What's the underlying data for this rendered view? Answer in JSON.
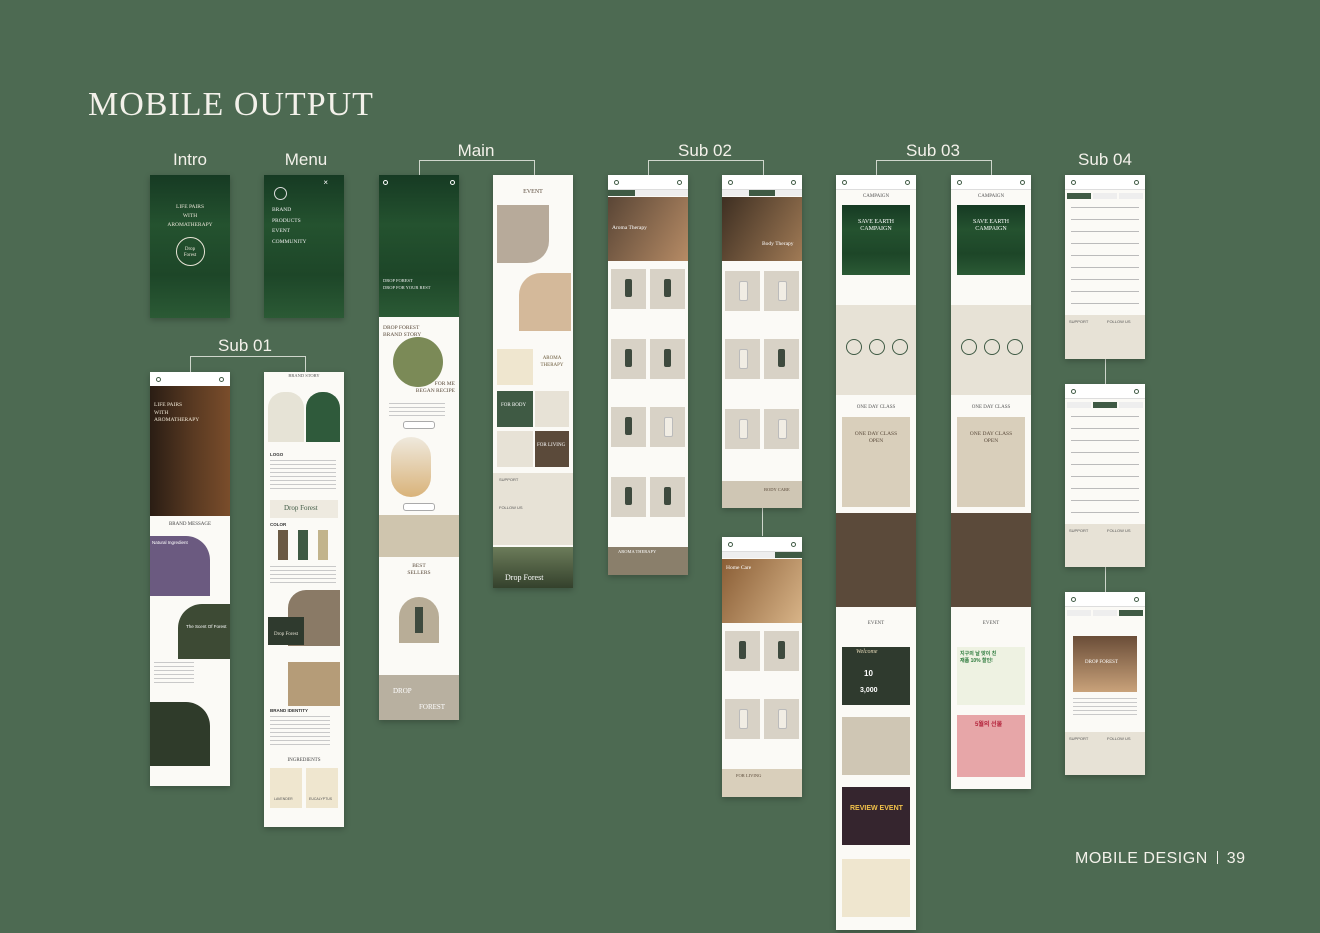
{
  "page": {
    "title": "MOBILE OUTPUT",
    "footer_label": "MOBILE DESIGN",
    "page_number": "39"
  },
  "groups": {
    "intro": "Intro",
    "menu": "Menu",
    "main": "Main",
    "sub01": "Sub 01",
    "sub02": "Sub 02",
    "sub03": "Sub 03",
    "sub04": "Sub 04"
  },
  "intro_screen": {
    "tagline_1": "LIFE PAIRS",
    "tagline_2": "WITH",
    "tagline_3": "AROMATHERAPY",
    "logo_1": "Drop",
    "logo_2": "Forest"
  },
  "menu_screen": {
    "items": [
      "BRAND",
      "PRODUCTS",
      "EVENT",
      "COMMUNITY"
    ],
    "close": "×"
  },
  "main_screen": {
    "hero_1": "DROP FOREST",
    "hero_2": "DROP FOR YOUR REST",
    "story_title_1": "DROP FOREST",
    "story_title_2": "BRAND STORY",
    "story_sub_1": "FOR ME",
    "story_sub_2": "BEGAN RECIPE",
    "best_1": "BEST",
    "best_2": "SELLERS",
    "event": "EVENT",
    "aroma_1": "AROMA",
    "aroma_2": "THERAPY",
    "for_body": "FOR BODY",
    "for_living": "FOR LIVING",
    "support": "SUPPORT",
    "follow": "FOLLOW US",
    "footer_logo": "Drop Forest",
    "drop_bottom": "DROP",
    "forest_bottom": "FOREST"
  },
  "sub01": {
    "hero_1": "LIFE PAIRS",
    "hero_2": "WITH",
    "hero_3": "AROMATHERAPY",
    "brand_message": "BRAND MESSAGE",
    "natural": "Natural Ingredient",
    "scent": "The Scent Of Forest",
    "brand_story": "BRAND STORY",
    "logo": "LOGO",
    "color": "COLOR",
    "brand_identity": "BRAND IDENTITY",
    "ingredients": "INGREDIENTS",
    "lavender": "LAVENDER",
    "eucalyptus": "EUCALYPTUS",
    "logo_word": "Drop Forest"
  },
  "sub02": {
    "aroma": "Aroma Therapy",
    "body": "Body Therapy",
    "body_care": "BODY CARE",
    "home": "Home Care",
    "aroma_footer": "AROMA THERAPY",
    "forliving": "FOR LIVING"
  },
  "sub03": {
    "campaign": "CAMPAIGN",
    "save_1": "SAVE EARTH",
    "save_2": "CAMPAIGN",
    "one_day": "ONE DAY CLASS",
    "one_day_1": "ONE DAY CLASS",
    "one_day_2": "OPEN",
    "event": "EVENT",
    "welcome": "Welcome",
    "ten": "10",
    "three": "3,000",
    "review": "REVIEW EVENT",
    "promo_kr": "지구의 날 맞이 친재품 10% 할인!",
    "may_kr": "5월의 선물"
  },
  "sub04": {
    "support": "SUPPORT",
    "follow": "FOLLOW US",
    "store": "DROP FOREST"
  }
}
